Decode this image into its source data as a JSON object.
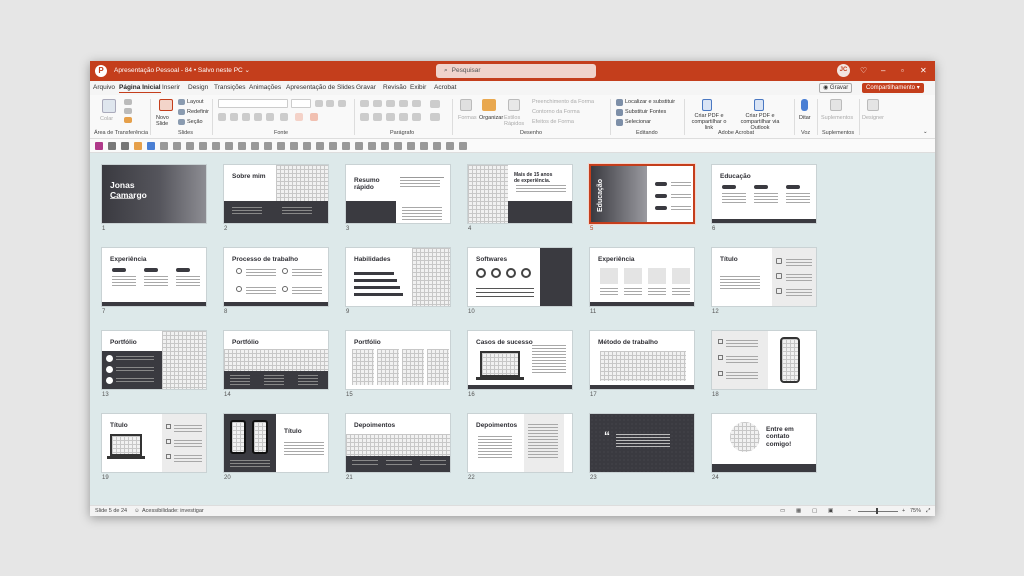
{
  "window": {
    "doc_title": "Apresentação Pessoal - 84 • Salvo neste PC ⌄",
    "search_placeholder": "Pesquisar",
    "avatar_initials": "JC",
    "accent_color": "#c43e1c"
  },
  "menu": {
    "items": [
      "Arquivo",
      "Página Inicial",
      "Inserir",
      "Design",
      "Transições",
      "Animações",
      "Apresentação de Slides",
      "Gravar",
      "Revisão",
      "Exibir",
      "Acrobat"
    ],
    "active": "Página Inicial",
    "record_label": "◉ Gravar",
    "share_label": "Compartilhamento ▾"
  },
  "ribbon": {
    "clipboard": {
      "paste": "Colar",
      "group": "Área de Transferência"
    },
    "slides": {
      "new_slide": "Novo Slide",
      "layout": "Layout",
      "reset": "Redefinir",
      "section": "Seção",
      "group": "Slides"
    },
    "font": {
      "group": "Fonte"
    },
    "paragraph": {
      "group": "Parágrafo"
    },
    "drawing": {
      "shapes": "Formas",
      "arrange": "Organizar",
      "quick_styles": "Estilos Rápidos",
      "fill": "Preenchimento da Forma",
      "outline": "Contorno da Forma",
      "effects": "Efeitos de Forma",
      "group": "Desenho"
    },
    "editing": {
      "find": "Localizar e substituir",
      "replace_fonts": "Substituir Fontes",
      "select": "Selecionar",
      "group": "Editando"
    },
    "acrobat": {
      "create_pdf": "Criar PDF e compartilhar o link",
      "create_pdf_outlook": "Criar PDF e compartilhar via Outlook",
      "group": "Adobe Acrobat"
    },
    "voice": {
      "dictate": "Ditar",
      "group": "Voz"
    },
    "addins": {
      "label": "Suplementos",
      "group": "Suplementos"
    },
    "designer": {
      "label": "Designer"
    }
  },
  "slides": [
    {
      "num": "1",
      "title": "Jonas\nCamargo",
      "dark": true
    },
    {
      "num": "2",
      "title": "Sobre mim"
    },
    {
      "num": "3",
      "title": "Resumo\nrápido"
    },
    {
      "num": "4",
      "title": "Mais de 15 anos\nde experiência."
    },
    {
      "num": "5",
      "title": "Educação",
      "selected": true
    },
    {
      "num": "6",
      "title": "Educação"
    },
    {
      "num": "7",
      "title": "Experiência"
    },
    {
      "num": "8",
      "title": "Processo de trabalho"
    },
    {
      "num": "9",
      "title": "Habilidades"
    },
    {
      "num": "10",
      "title": "Softwares"
    },
    {
      "num": "11",
      "title": "Experiência"
    },
    {
      "num": "12",
      "title": "Título"
    },
    {
      "num": "13",
      "title": "Portfólio"
    },
    {
      "num": "14",
      "title": "Portfólio"
    },
    {
      "num": "15",
      "title": "Portfólio"
    },
    {
      "num": "16",
      "title": "Casos de sucesso"
    },
    {
      "num": "17",
      "title": "Método de trabalho"
    },
    {
      "num": "18",
      "title": ""
    },
    {
      "num": "19",
      "title": "Título"
    },
    {
      "num": "20",
      "title": "Título"
    },
    {
      "num": "21",
      "title": "Depoimentos"
    },
    {
      "num": "22",
      "title": "Depoimentos"
    },
    {
      "num": "23",
      "title": "",
      "dark": true
    },
    {
      "num": "24",
      "title": "Entre em\ncontato\ncomigo!"
    }
  ],
  "status": {
    "slide_position": "Slide 5 de 24",
    "accessibility": "Acessibilidade: investigar",
    "zoom": "75%"
  }
}
